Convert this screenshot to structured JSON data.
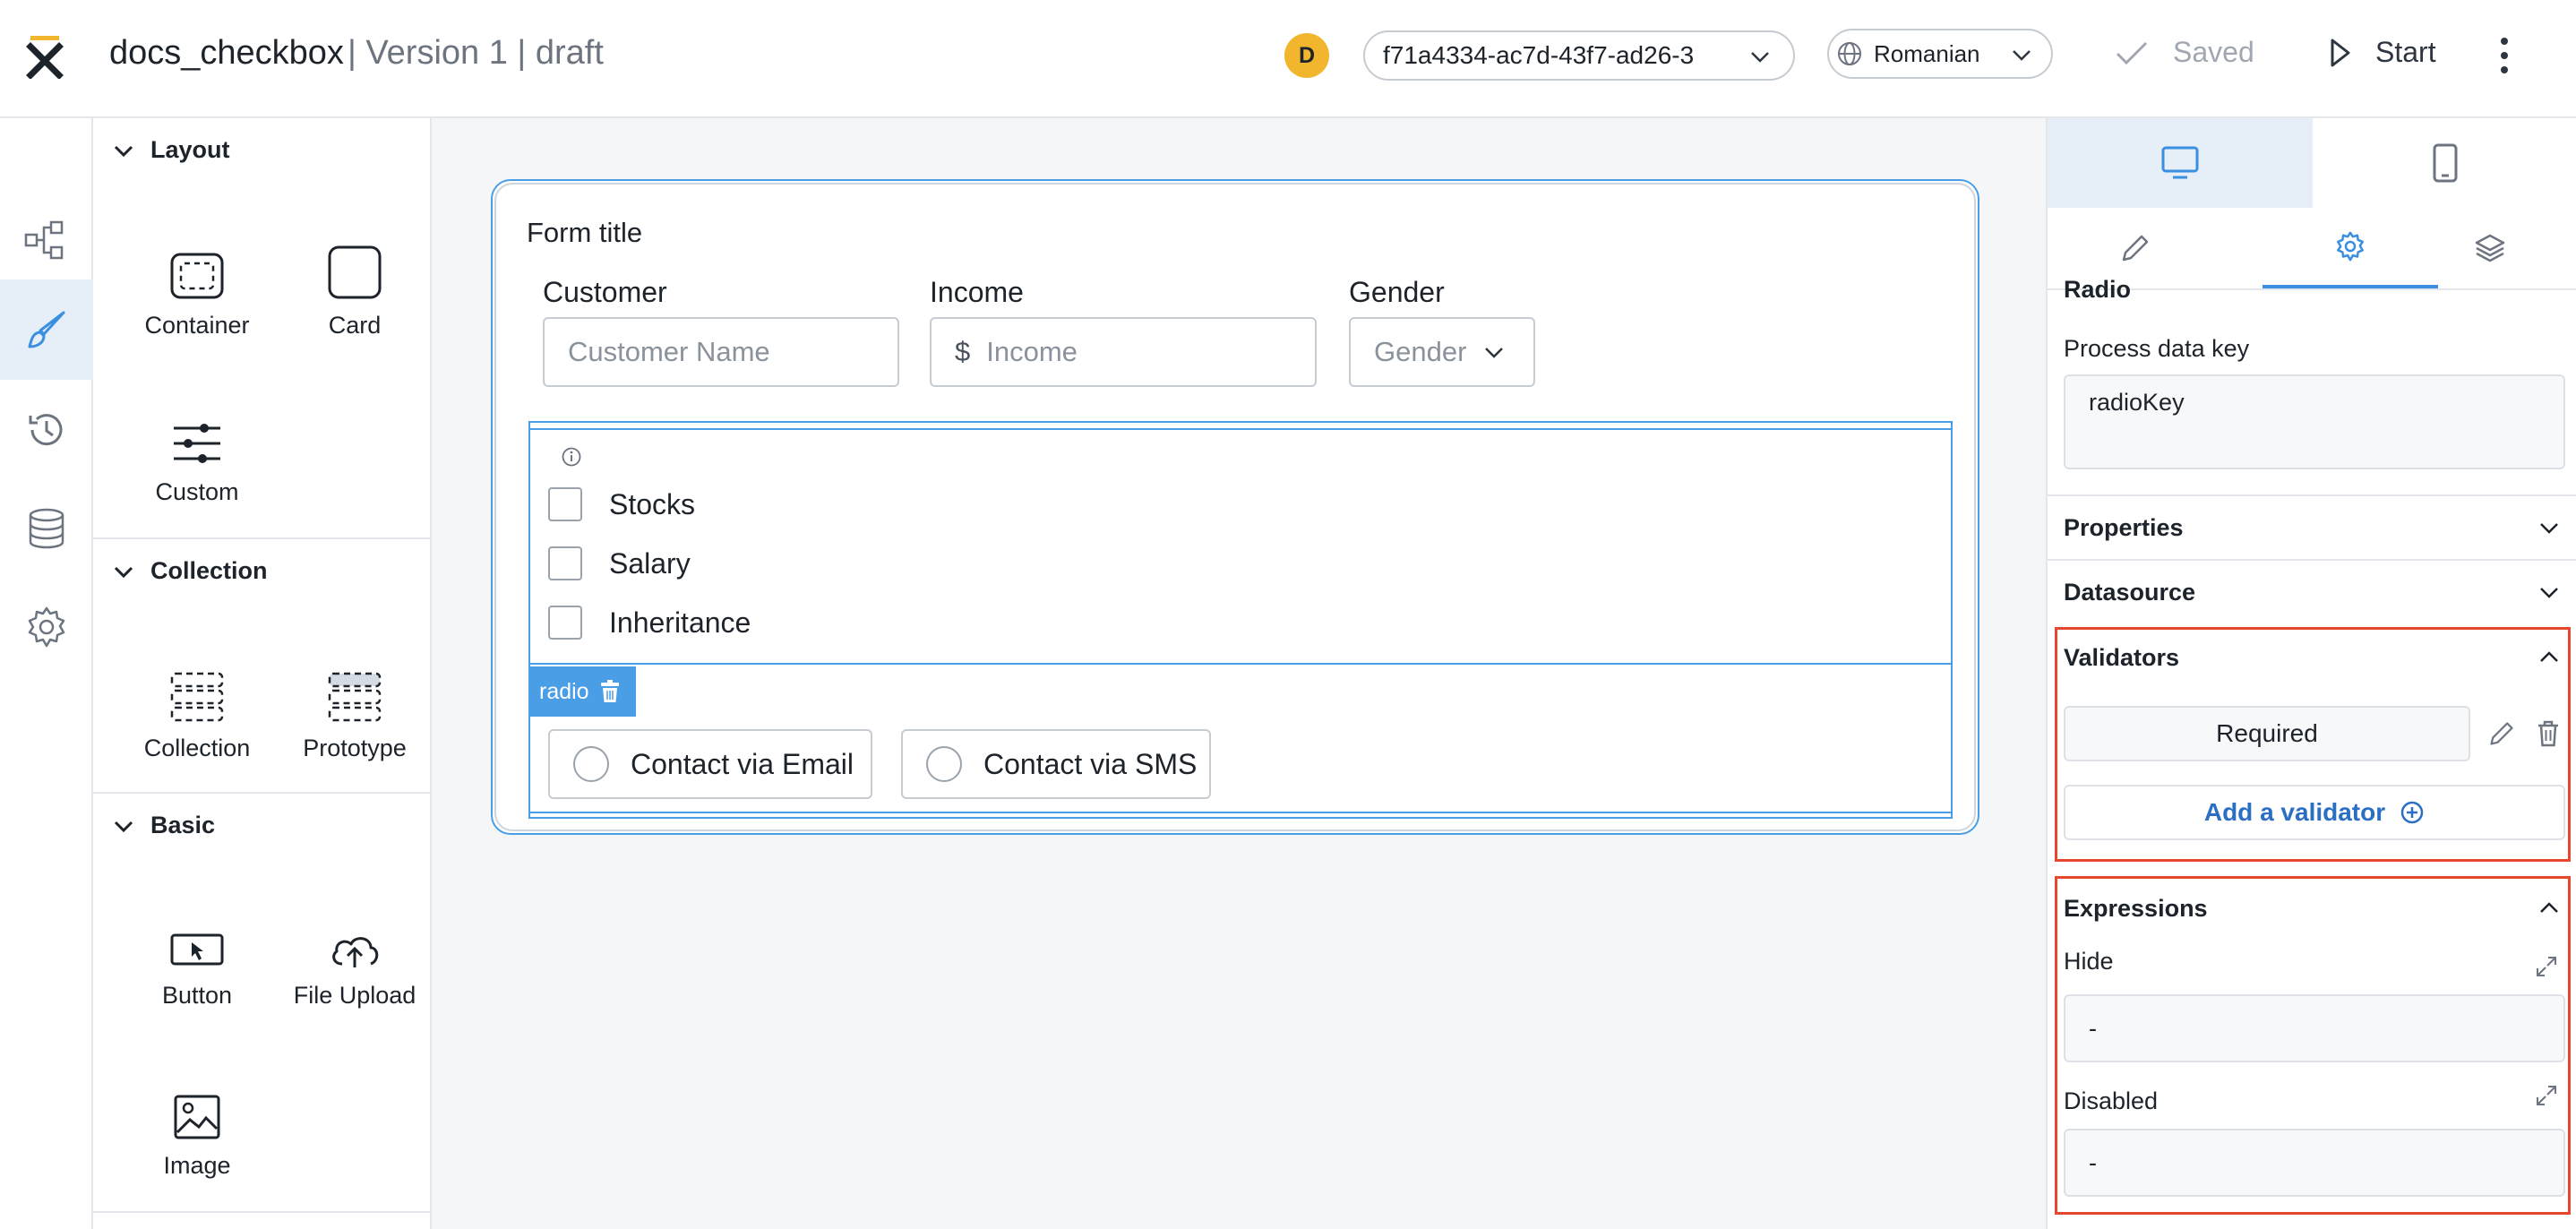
{
  "header": {
    "app_name": "docs_checkbox",
    "version_label": "| Version 1 | draft",
    "avatar_initial": "D",
    "process_id": "f71a4334-ac7d-43f7-ad26-3",
    "language": "Romanian",
    "saved_label": "Saved",
    "start_label": "Start"
  },
  "palette": {
    "layout_title": "Layout",
    "layout_items": [
      "Container",
      "Card",
      "Custom"
    ],
    "collection_title": "Collection",
    "collection_items": [
      "Collection",
      "Prototype"
    ],
    "basic_title": "Basic",
    "basic_items": [
      "Button",
      "File Upload",
      "Image"
    ]
  },
  "form": {
    "title": "Form title",
    "customer_label": "Customer",
    "customer_placeholder": "Customer Name",
    "income_label": "Income",
    "income_prefix": "$",
    "income_placeholder": "Income",
    "gender_label": "Gender",
    "gender_placeholder": "Gender",
    "checkbox_options": [
      "Stocks",
      "Salary",
      "Inheritance"
    ],
    "radio_tag": "radio",
    "radio_options": [
      "Contact via Email",
      "Contact via SMS"
    ]
  },
  "props": {
    "component_type": "Radio",
    "process_key_label": "Process data key",
    "process_key_value": "radioKey",
    "properties_label": "Properties",
    "datasource_label": "Datasource",
    "validators_label": "Validators",
    "required_label": "Required",
    "add_validator_label": "Add a validator",
    "expressions_label": "Expressions",
    "hide_label": "Hide",
    "hide_value": "-",
    "disabled_label": "Disabled",
    "disabled_value": "-"
  },
  "colors": {
    "accent": "#4a9ee6",
    "highlight": "#e8472f",
    "link": "#2a6fc4",
    "avatar": "#f1b52e"
  }
}
